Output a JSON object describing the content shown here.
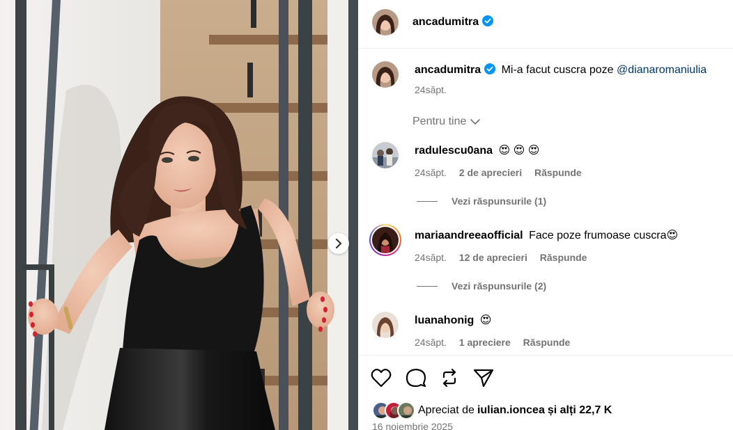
{
  "post": {
    "author": "ancadumitra",
    "caption_text": "Mi-a facut cuscra poze",
    "caption_mention": "@dianaromaniulia",
    "caption_time": "24săpt."
  },
  "sort_label": "Pentru tine",
  "comments": [
    {
      "user": "radulescu0ana",
      "text": "😍 😍 😍",
      "time": "24săpt.",
      "likes": "2 de aprecieri",
      "reply": "Răspunde",
      "view_replies": "Vezi răspunsurile (1)"
    },
    {
      "user": "mariaandreeaofficial",
      "text": "Face poze frumoase cuscra😍",
      "time": "24săpt.",
      "likes": "12 de aprecieri",
      "reply": "Răspunde",
      "view_replies": "Vezi răspunsurile (2)"
    },
    {
      "user": "luanahonig",
      "text": "😍",
      "time": "24săpt.",
      "likes": "1 apreciere",
      "reply": "Răspunde"
    }
  ],
  "likes_summary": {
    "prefix": "Apreciat de",
    "user": "iulian.ioncea",
    "suffix": "și alți 22,7 K"
  },
  "post_date": "16 noiembrie 2025",
  "icons": [
    "chevron-right-icon",
    "verified-badge-icon",
    "chevron-down-icon",
    "heart-icon",
    "comment-icon",
    "repost-icon",
    "share-icon"
  ],
  "colors": {
    "link": "#00376b",
    "verified": "#0095f6",
    "muted": "#737373",
    "story_ring": "#d6249f"
  }
}
